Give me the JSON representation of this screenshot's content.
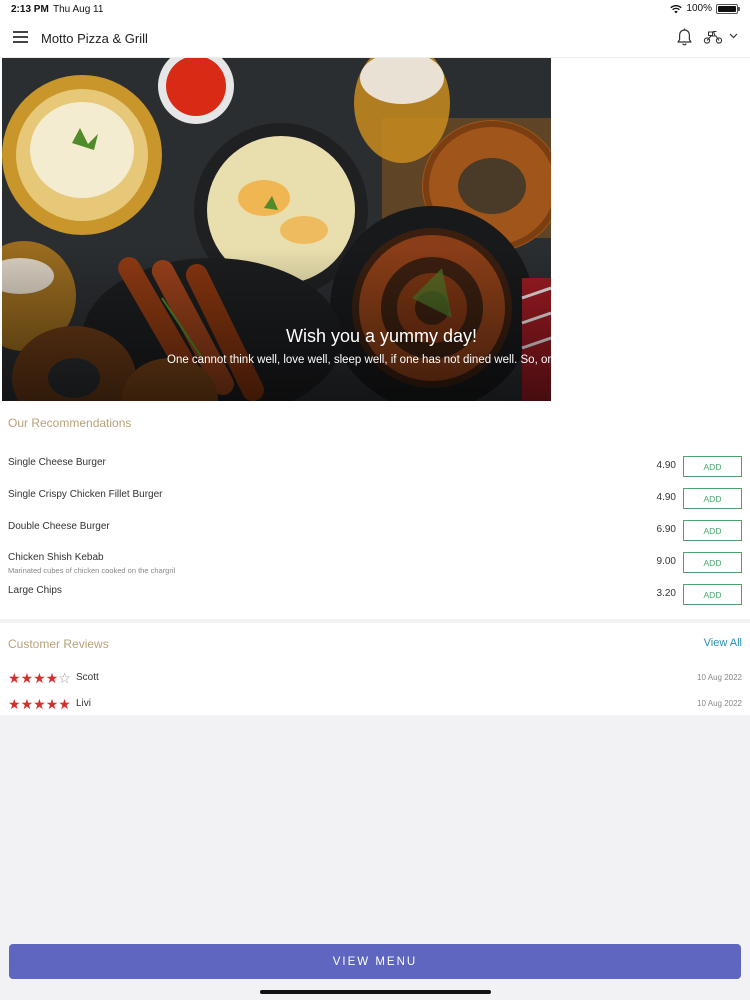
{
  "status_bar": {
    "time": "2:13 PM",
    "date": "Thu Aug 11",
    "battery": "100%"
  },
  "header": {
    "title": "Motto Pizza & Grill"
  },
  "hero": {
    "title": "Wish you a yummy day!",
    "subtitle": "One cannot think well, love well, sleep well, if one has not dined well. So, order"
  },
  "recommendations": {
    "title": "Our Recommendations",
    "add_label": "ADD",
    "items": [
      {
        "name": "Single Cheese Burger",
        "description": "",
        "price": "4.90"
      },
      {
        "name": "Single Crispy Chicken Fillet Burger",
        "description": "",
        "price": "4.90"
      },
      {
        "name": "Double Cheese Burger",
        "description": "",
        "price": "6.90"
      },
      {
        "name": "Chicken Shish Kebab",
        "description": "Marinated cubes of chicken cooked on the chargril",
        "price": "9.00"
      },
      {
        "name": "Large Chips",
        "description": "",
        "price": "3.20"
      }
    ]
  },
  "reviews": {
    "title": "Customer Reviews",
    "view_all": "View All",
    "items": [
      {
        "name": "Scott",
        "rating": 4,
        "max_rating": 5,
        "date": "10 Aug 2022"
      },
      {
        "name": "Livi",
        "rating": 5,
        "max_rating": 5,
        "date": "10 Aug 2022"
      }
    ]
  },
  "footer": {
    "view_menu": "VIEW MENU"
  },
  "colors": {
    "accent": "#5e66c0",
    "add_green": "#4aa36b",
    "section_title": "#b8a27a",
    "star_red": "#d32f2f",
    "link": "#2b8fb3"
  }
}
